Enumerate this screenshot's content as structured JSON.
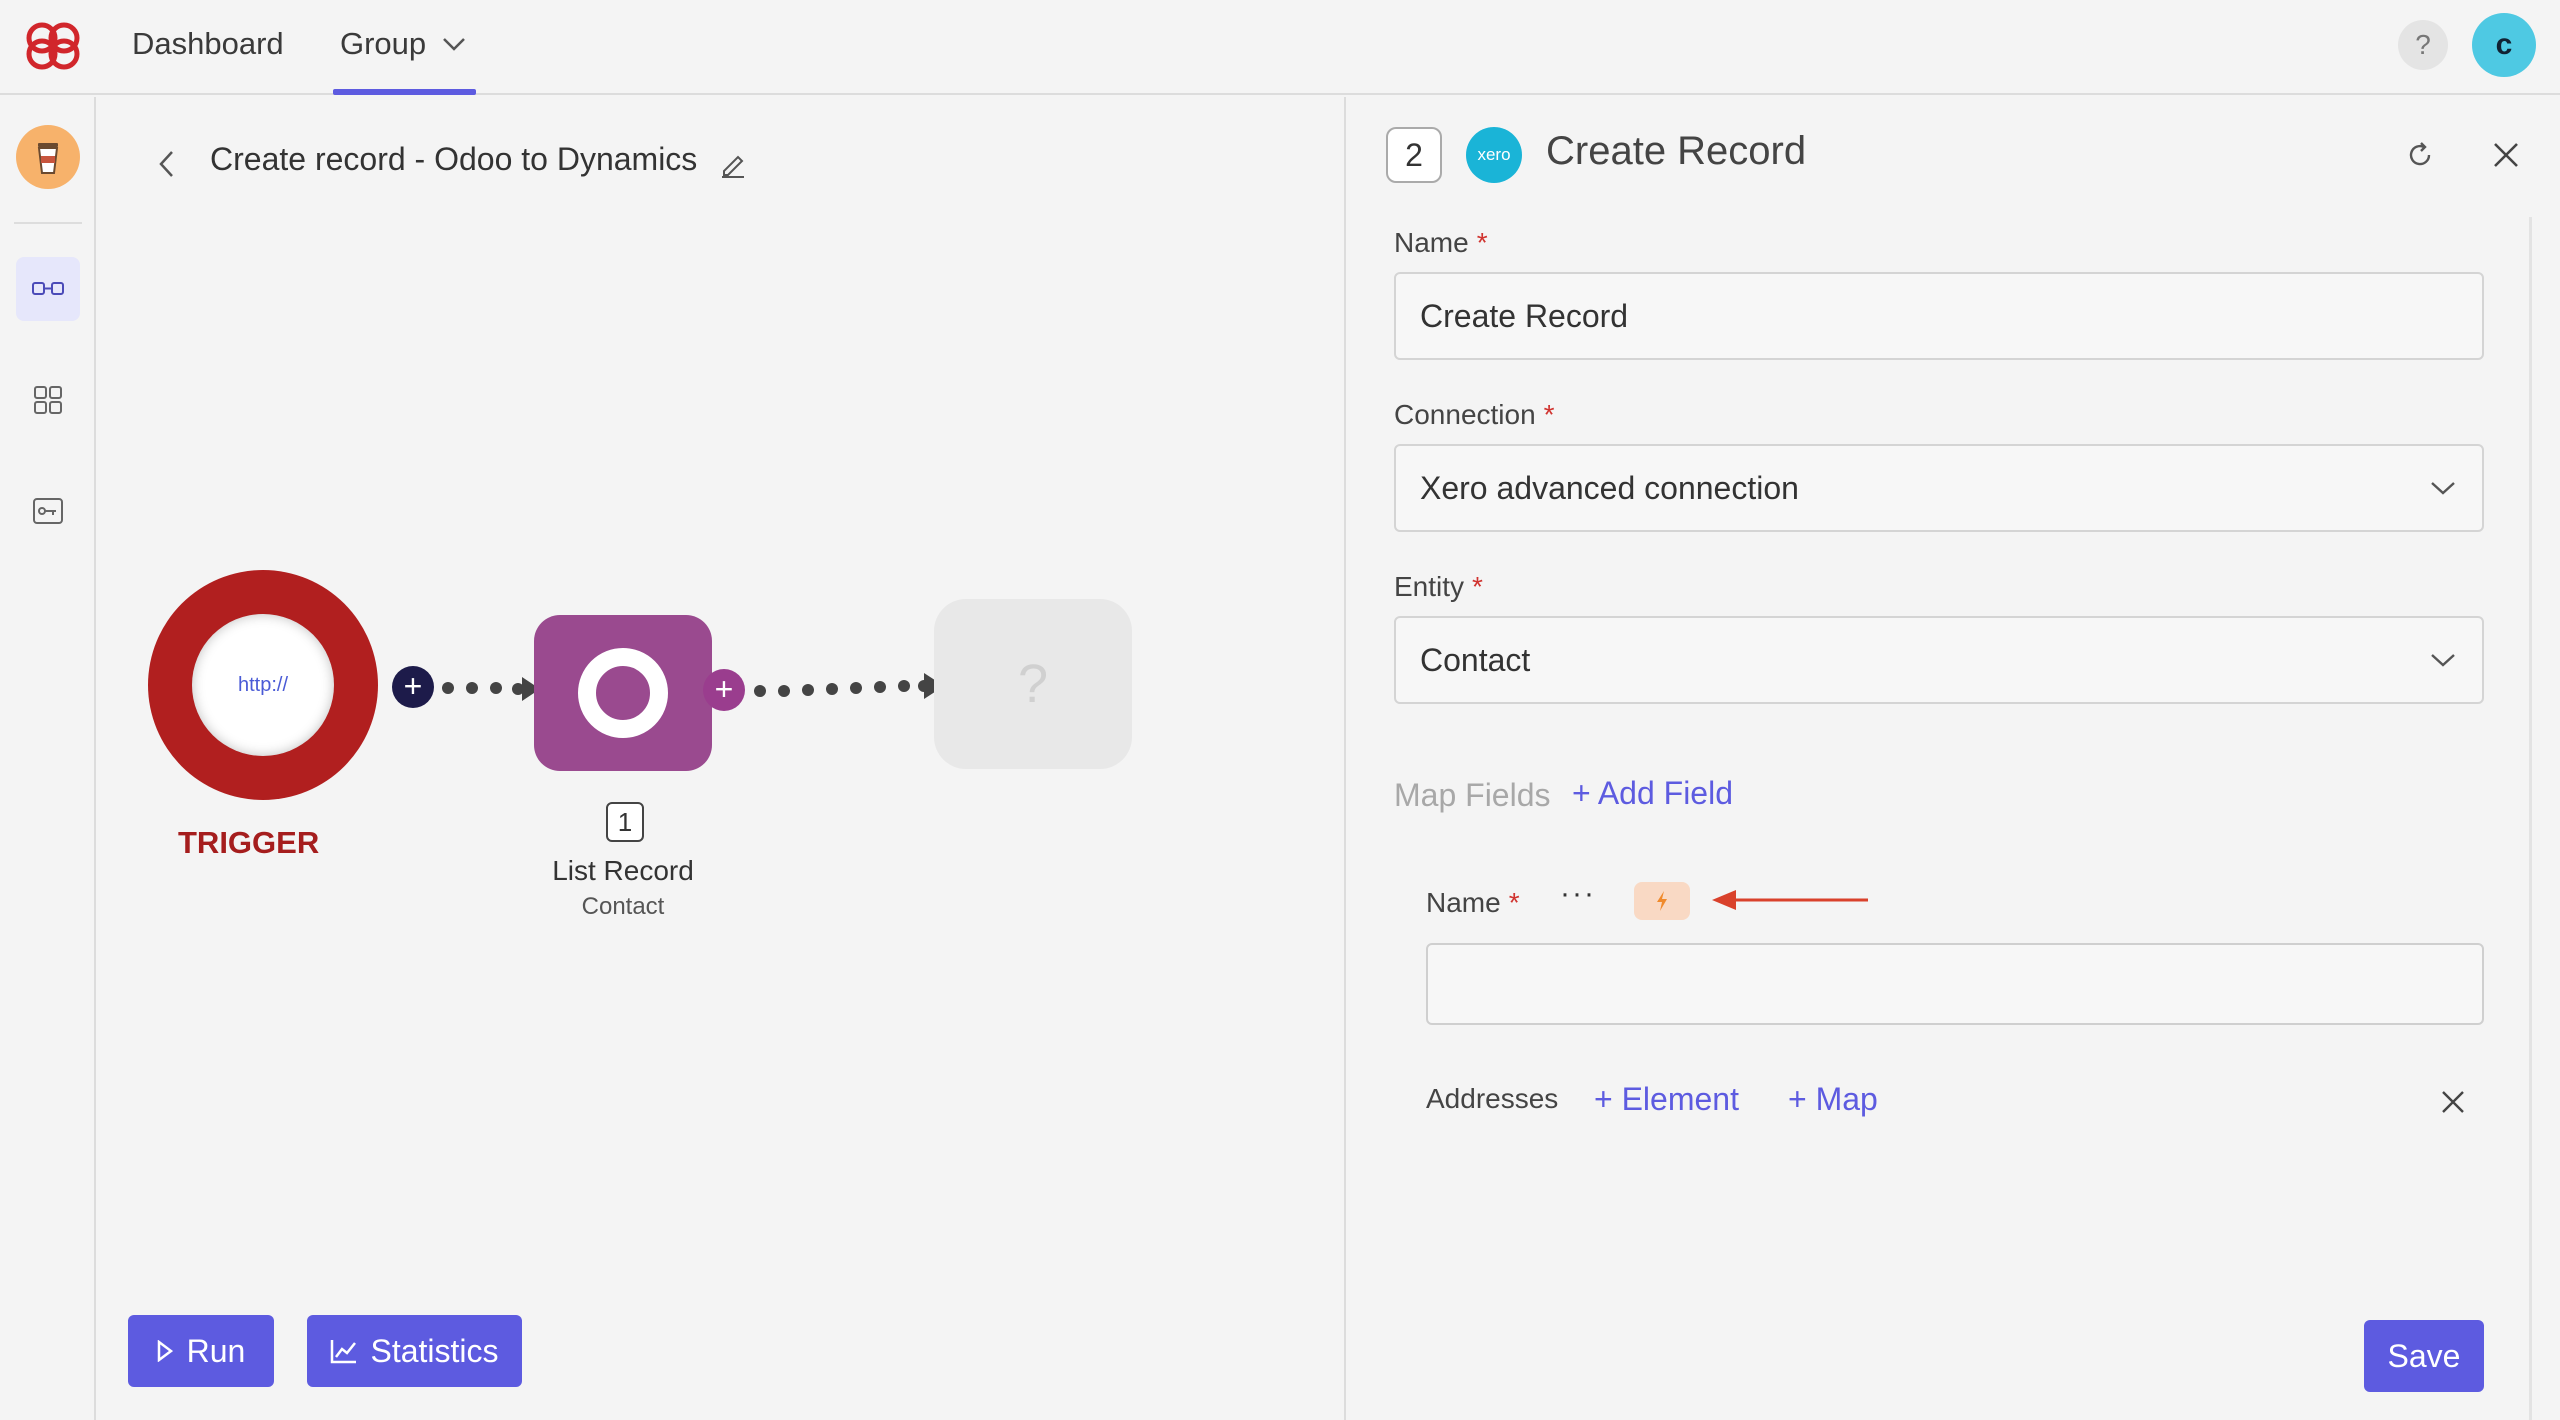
{
  "nav": {
    "dashboard": "Dashboard",
    "group": "Group",
    "help": "?",
    "user_initial": "c"
  },
  "flow": {
    "title": "Create record - Odoo to Dynamics",
    "trigger": {
      "inner_text": "http://",
      "label": "TRIGGER"
    },
    "node": {
      "step": "1",
      "title": "List Record",
      "subtitle": "Contact"
    },
    "empty_node_glyph": "?",
    "run_label": "Run",
    "statistics_label": "Statistics"
  },
  "panel": {
    "step": "2",
    "app_badge": "xero",
    "title": "Create Record",
    "fields": {
      "name_label": "Name",
      "name_value": "Create Record",
      "connection_label": "Connection",
      "connection_value": "Xero advanced connection",
      "entity_label": "Entity",
      "entity_value": "Contact"
    },
    "required_mark": "*",
    "map_fields_label": "Map Fields",
    "add_field_label": "+ Add Field",
    "mapped_name_label": "Name",
    "mapped_name_value": "",
    "more_label": "···",
    "addresses_label": "Addresses",
    "add_element_label": "+ Element",
    "add_map_label": "+ Map",
    "save_label": "Save"
  },
  "colors": {
    "accent": "#5d5be0",
    "trigger": "#b11f1f",
    "node": "#9a4a8f",
    "xero": "#1ab4d7",
    "required": "#d0332f",
    "annotation_arrow": "#d9412b"
  }
}
